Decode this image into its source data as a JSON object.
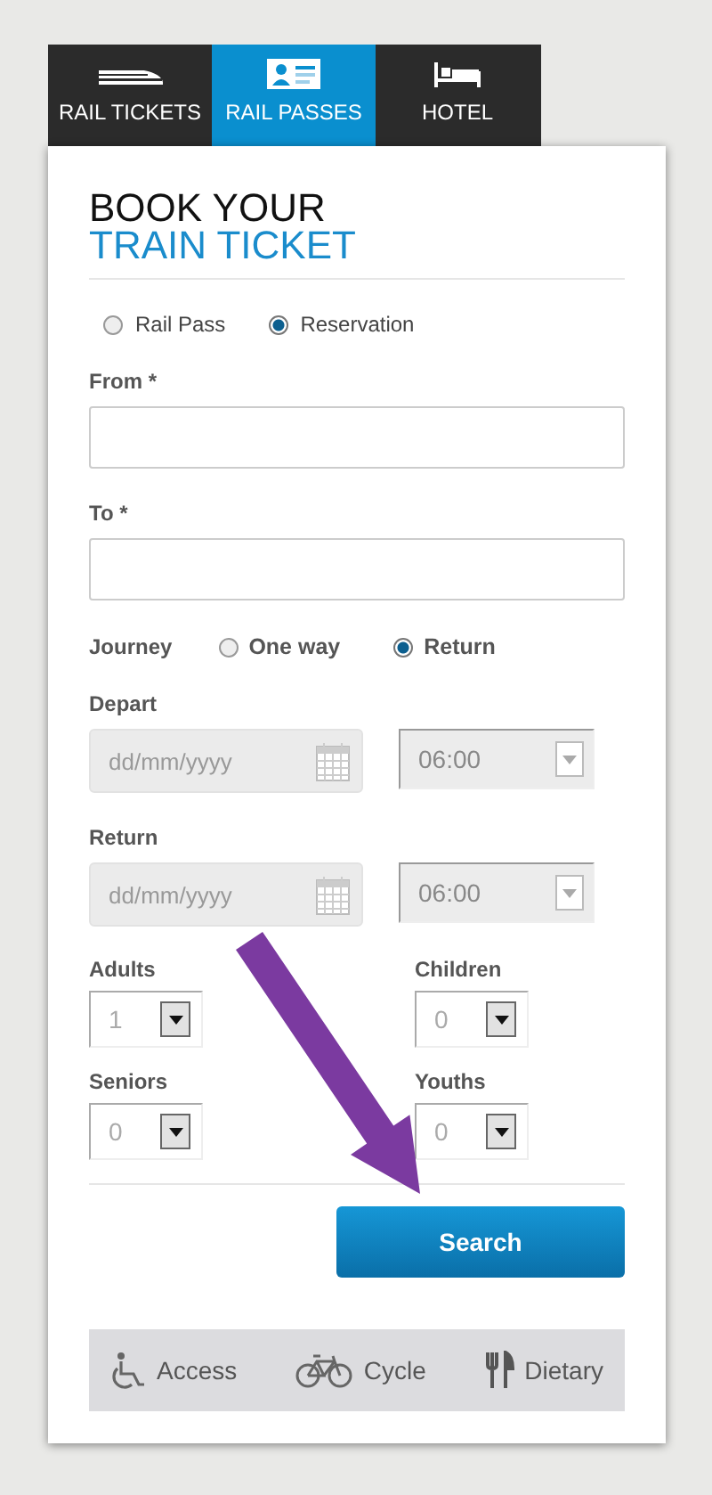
{
  "tabs": [
    {
      "label": "RAIL TICKETS",
      "kind": "train",
      "selected": false
    },
    {
      "label": "RAIL PASSES",
      "kind": "card",
      "selected": true
    },
    {
      "label": "HOTEL",
      "kind": "bed",
      "selected": false
    }
  ],
  "heading": {
    "line_1": "BOOK YOUR",
    "line_2": "TRAIN TICKET"
  },
  "ticket_type": [
    {
      "label": "Rail Pass",
      "selected": false
    },
    {
      "label": "Reservation",
      "selected": true
    }
  ],
  "from": {
    "label": "From *"
  },
  "to": {
    "label": "To *"
  },
  "journey": {
    "label": "Journey",
    "options": [
      {
        "label": "One way",
        "selected": false
      },
      {
        "label": "Return",
        "selected": true
      }
    ]
  },
  "dates": [
    {
      "label": "Depart",
      "placeholder": "dd/mm/yyyy",
      "time": "06:00",
      "disabled": true
    },
    {
      "label": "Return",
      "placeholder": "dd/mm/yyyy",
      "time": "06:00",
      "disabled": true
    }
  ],
  "passengers": [
    {
      "label": "Adults",
      "value": "1"
    },
    {
      "label": "Children",
      "value": "0"
    },
    {
      "label": "Seniors",
      "value": "0"
    },
    {
      "label": "Youths",
      "value": "0"
    }
  ],
  "search_button": "Search",
  "extras": [
    {
      "label": "Access",
      "kind": "wheelchair"
    },
    {
      "label": "Cycle",
      "kind": "bicycle"
    },
    {
      "label": "Dietary",
      "kind": "cutlery"
    }
  ],
  "annotation": {
    "kind": "arrow"
  }
}
